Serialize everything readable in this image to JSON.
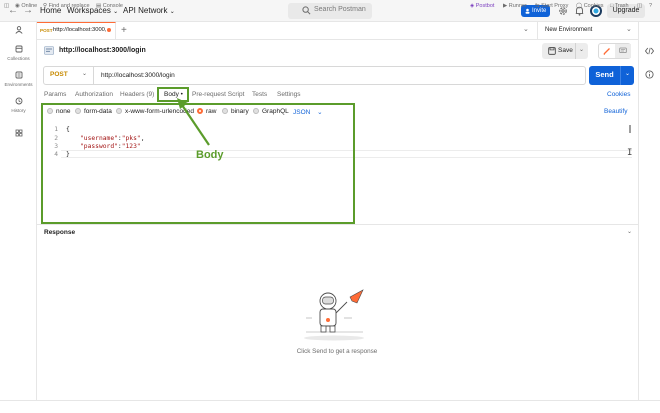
{
  "header": {
    "home": "Home",
    "workspaces": "Workspaces",
    "api_network": "API Network",
    "search_placeholder": "Search Postman",
    "invite": "Invite",
    "upgrade": "Upgrade"
  },
  "sidebar": {
    "items": [
      {
        "label": ""
      },
      {
        "label": "Collections"
      },
      {
        "label": "Environments"
      },
      {
        "label": "History"
      },
      {
        "label": ""
      }
    ]
  },
  "tab": {
    "method": "POST",
    "url": "http://localhost:3000,",
    "environment": "New Environment"
  },
  "request": {
    "title": "http://localhost:3000/login",
    "save": "Save",
    "method": "POST",
    "url": "http://localhost:3000/login",
    "send": "Send",
    "tabs": [
      "Params",
      "Authorization",
      "Headers (9)",
      "Body •",
      "Pre-request Script",
      "Tests",
      "Settings"
    ],
    "cookies": "Cookies",
    "body_options": [
      "none",
      "form-data",
      "x-www-form-urlencoded",
      "raw",
      "binary",
      "GraphQL"
    ],
    "format": "JSON",
    "beautify": "Beautify",
    "code_lines": [
      "1",
      "2",
      "3",
      "4"
    ],
    "code": {
      "open": "{",
      "key1": "\"username\"",
      "val1": "\"pks\"",
      "key2": "\"password\"",
      "val2": "\"123\"",
      "close": "}"
    }
  },
  "annotation": {
    "label": "Body",
    "color": "#5b9c2b"
  },
  "response": {
    "title": "Response",
    "empty": "Click Send to get a response"
  },
  "status": {
    "online": "Online",
    "find_replace": "Find and replace",
    "console": "Console",
    "postbot": "Postbot",
    "runner": "Runner",
    "start_proxy": "Start Proxy",
    "cookies": "Cookies",
    "trash": "Trash"
  },
  "colors": {
    "accent": "#ff6c37",
    "primary": "#0f62d8",
    "highlight": "#5b9c2b"
  }
}
